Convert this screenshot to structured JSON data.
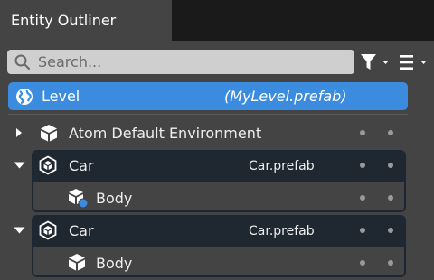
{
  "panel": {
    "title": "Entity Outliner"
  },
  "search": {
    "placeholder": "Search..."
  },
  "toolbar": {
    "filter_icon": "filter-icon",
    "menu_icon": "hamburger-menu-icon"
  },
  "colors": {
    "accent": "#3b8cde",
    "background": "#444444",
    "prefab_header": "#1f2731",
    "search_bg": "#cfcfcf"
  },
  "level": {
    "label": "Level",
    "file": "(MyLevel.prefab)"
  },
  "entities": [
    {
      "label": "Atom Default Environment",
      "expanded": false,
      "icon": "cube-icon"
    },
    {
      "label": "Car",
      "file": "Car.prefab",
      "expanded": true,
      "icon": "prefab-icon",
      "children": [
        {
          "label": "Body",
          "icon": "cube-component-icon"
        }
      ]
    },
    {
      "label": "Car",
      "file": "Car.prefab",
      "expanded": true,
      "icon": "prefab-icon",
      "children": [
        {
          "label": "Body",
          "icon": "cube-icon"
        }
      ]
    }
  ]
}
